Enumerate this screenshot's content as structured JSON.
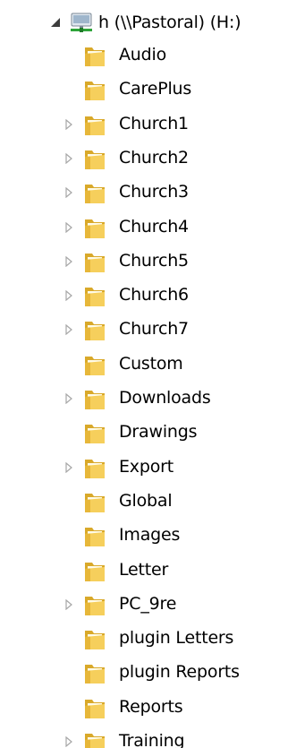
{
  "root": {
    "label": "h (\\\\Pastoral) (H:)",
    "icon": "network-drive-icon",
    "expanded": true
  },
  "folders": [
    {
      "name": "Audio",
      "has_children": false
    },
    {
      "name": "CarePlus",
      "has_children": false
    },
    {
      "name": "Church1",
      "has_children": true
    },
    {
      "name": "Church2",
      "has_children": true
    },
    {
      "name": "Church3",
      "has_children": true
    },
    {
      "name": "Church4",
      "has_children": true
    },
    {
      "name": "Church5",
      "has_children": true
    },
    {
      "name": "Church6",
      "has_children": true
    },
    {
      "name": "Church7",
      "has_children": true
    },
    {
      "name": "Custom",
      "has_children": false
    },
    {
      "name": "Downloads",
      "has_children": true
    },
    {
      "name": "Drawings",
      "has_children": false
    },
    {
      "name": "Export",
      "has_children": true
    },
    {
      "name": "Global",
      "has_children": false
    },
    {
      "name": "Images",
      "has_children": false
    },
    {
      "name": "Letter",
      "has_children": false
    },
    {
      "name": "PC_9re",
      "has_children": true
    },
    {
      "name": "plugin Letters",
      "has_children": false
    },
    {
      "name": "plugin Reports",
      "has_children": false
    },
    {
      "name": "Reports",
      "has_children": false
    },
    {
      "name": "Training",
      "has_children": true
    }
  ],
  "colors": {
    "folder_front": "#f6cf5c",
    "folder_back": "#d9a92a",
    "chevron": "#a6a6a6",
    "expander_filled": "#3c3c3c"
  }
}
